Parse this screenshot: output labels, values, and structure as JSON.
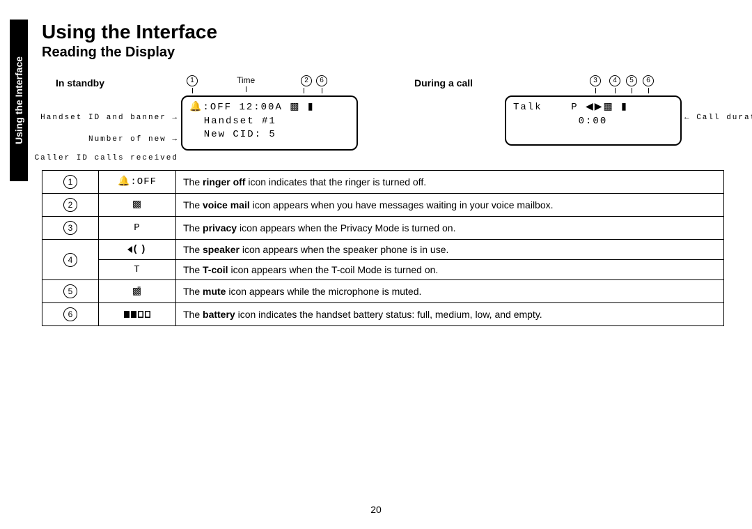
{
  "side_tab": "Using the Interface",
  "title": "Using the Interface",
  "subtitle": "Reading the Display",
  "page_number": "20",
  "standby": {
    "label": "In standby",
    "time_label": "Time",
    "markers": {
      "m1": "1",
      "m2": "2",
      "m6": "6"
    },
    "lcd_line1": "🔔:OFF 12:00A ▩ ▮",
    "lcd_line2": "  Handset #1",
    "lcd_line3": "  New CID: 5",
    "annot1": "Handset ID and banner",
    "annot2_a": "Number of new",
    "annot2_b": "Caller ID calls received"
  },
  "during": {
    "label": "During a call",
    "markers": {
      "m3": "3",
      "m4": "4",
      "m5": "5",
      "m6": "6"
    },
    "lcd_line1": "Talk    P ◀▶▩ ▮",
    "lcd_line2": "         0:00",
    "annot_right": "Call duration"
  },
  "rows": [
    {
      "num": "1",
      "icon": "🔔:OFF",
      "text_pre": "The ",
      "bold": "ringer off",
      "text_post": " icon indicates that the ringer is turned off."
    },
    {
      "num": "2",
      "icon": "▩",
      "text_pre": "The ",
      "bold": "voice mail",
      "text_post": " icon appears when you have messages waiting in your voice mailbox."
    },
    {
      "num": "3",
      "icon": "P",
      "text_pre": "The ",
      "bold": "privacy",
      "text_post": " icon appears when the Privacy Mode is turned on."
    },
    {
      "num": "4a",
      "icon": "speaker",
      "text_pre": "The ",
      "bold": "speaker",
      "text_post": " icon appears when the speaker phone is in use."
    },
    {
      "num": "4b",
      "icon": "T",
      "text_pre": "The ",
      "bold": "T-coil",
      "text_post": " icon appears when the T-coil Mode is turned on."
    },
    {
      "num": "5",
      "icon": "▩̄",
      "text_pre": "The ",
      "bold": "mute",
      "text_post": " icon appears while the microphone is muted."
    },
    {
      "num": "6",
      "icon": "battery",
      "text_pre": "The ",
      "bold": "battery",
      "text_post": " icon indicates the handset battery status: full, medium, low, and empty."
    }
  ],
  "row4_num": "4"
}
